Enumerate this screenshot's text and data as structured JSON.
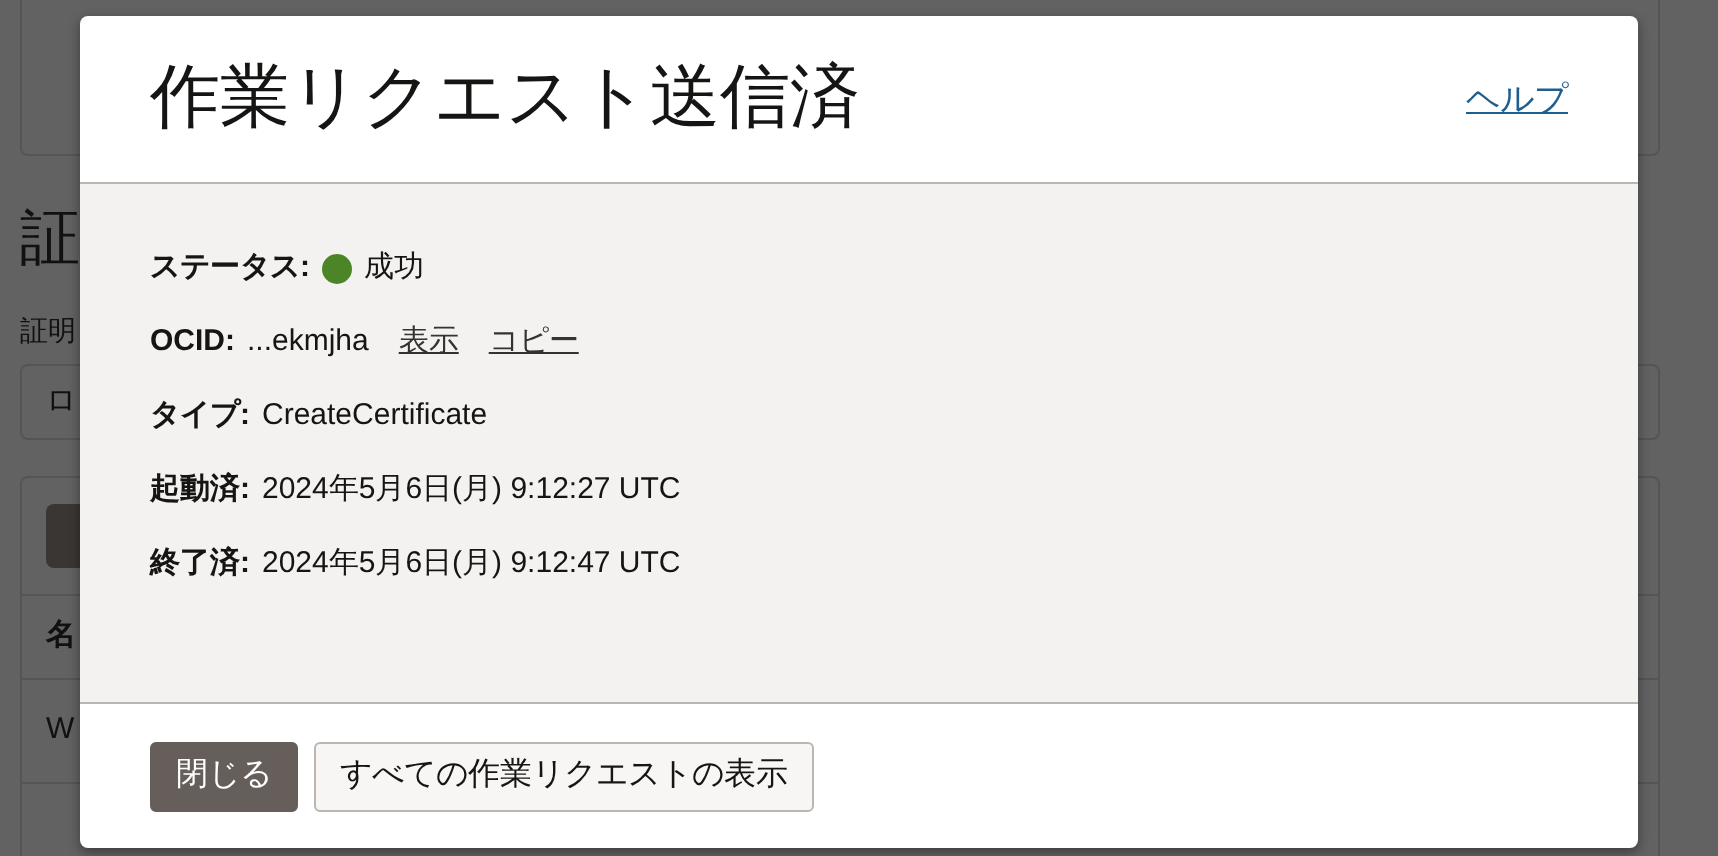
{
  "background": {
    "heading": "証",
    "field_label": "証明",
    "field_value": "ロ",
    "table_header": "名",
    "table_row": "W"
  },
  "dialog": {
    "title": "作業リクエスト送信済",
    "help_link": "ヘルプ",
    "fields": [
      {
        "kind": "status",
        "label": "ステータス:",
        "value": "成功",
        "color": "#4c8527"
      },
      {
        "kind": "ocid",
        "label": "OCID:",
        "value": "...ekmjha",
        "links": [
          "表示",
          "コピー"
        ]
      },
      {
        "kind": "text",
        "label": "タイプ:",
        "value": "CreateCertificate"
      },
      {
        "kind": "text",
        "label": "起動済:",
        "value": "2024年5月6日(月) 9:12:27 UTC"
      },
      {
        "kind": "text",
        "label": "終了済:",
        "value": "2024年5月6日(月) 9:12:47 UTC"
      }
    ],
    "buttons": [
      {
        "label": "閉じる",
        "kind": "primary"
      },
      {
        "label": "すべての作業リクエストの表示",
        "kind": "secondary"
      }
    ]
  }
}
